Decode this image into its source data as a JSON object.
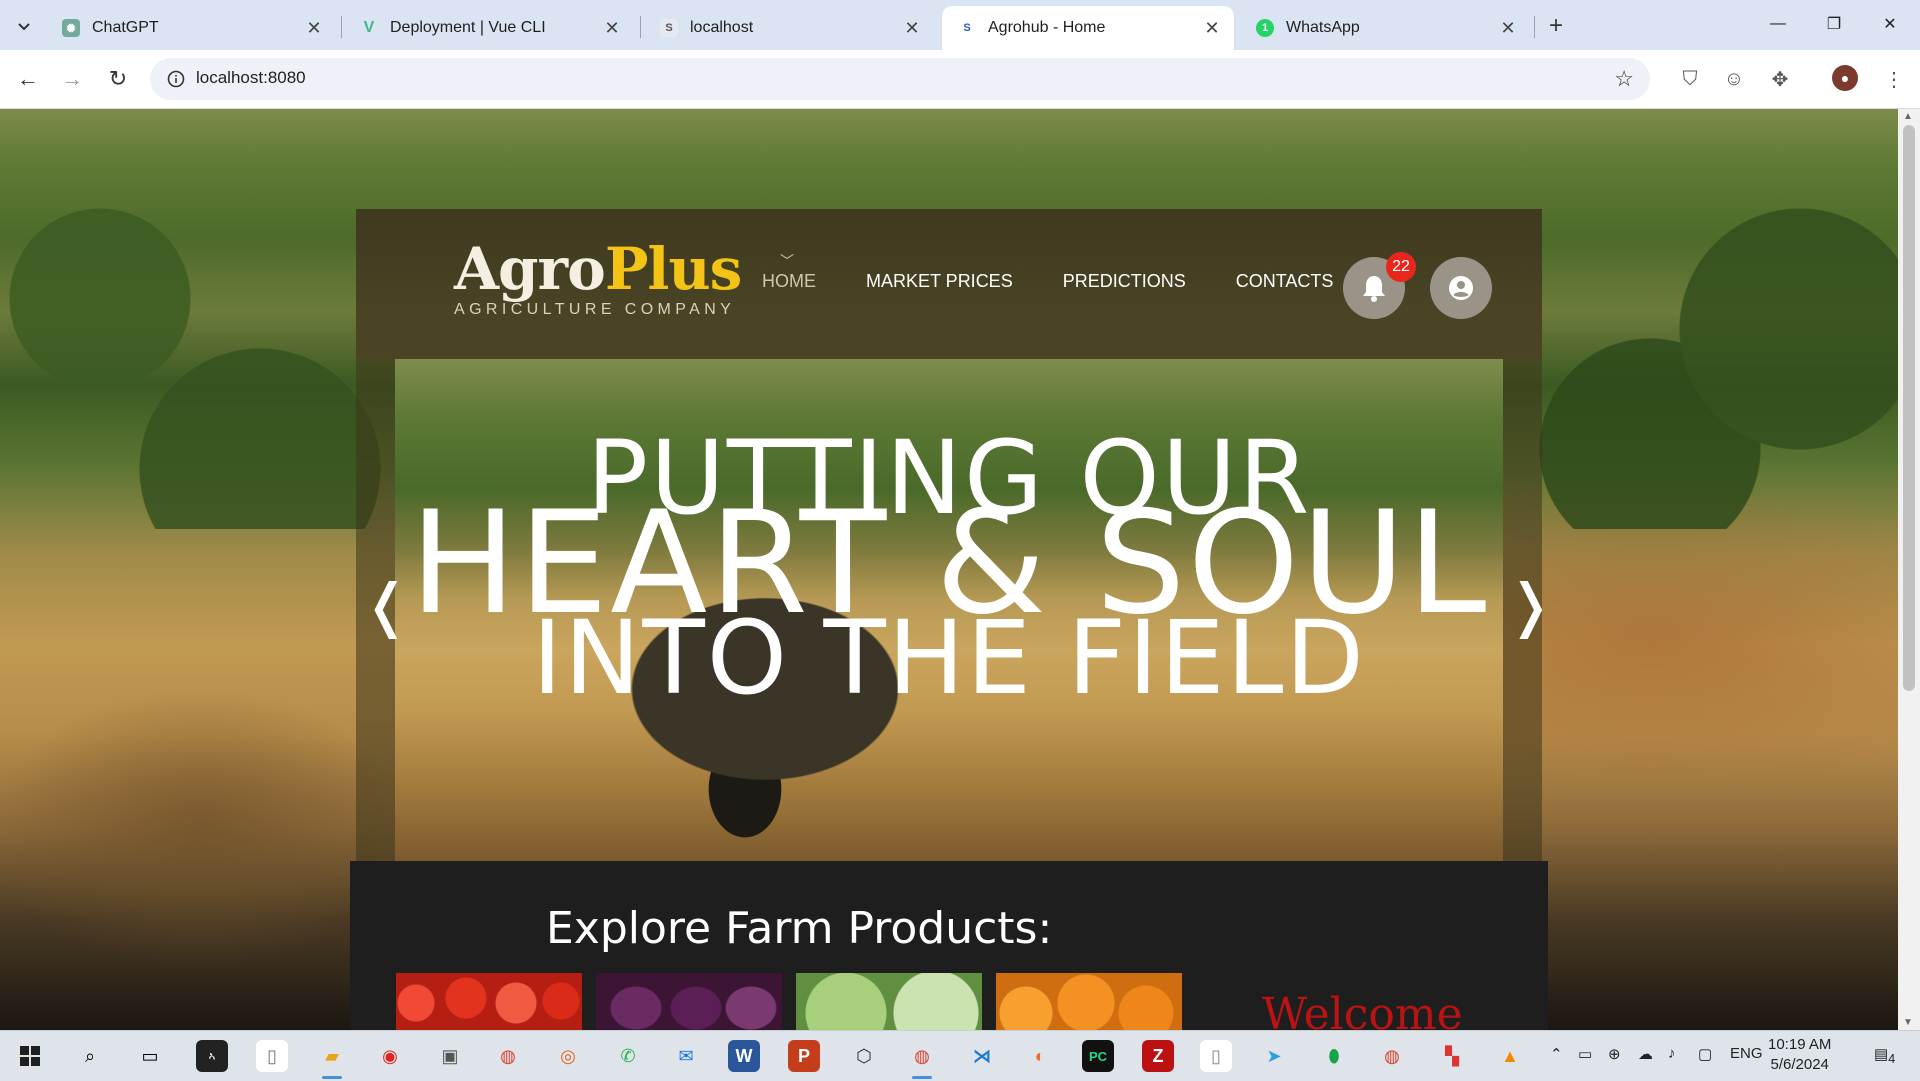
{
  "browser": {
    "tabs": [
      {
        "label": "ChatGPT",
        "icon": "chatgpt-icon",
        "active": false
      },
      {
        "label": "Deployment | Vue CLI",
        "icon": "vue-icon",
        "active": false
      },
      {
        "label": "localhost",
        "icon": "page-icon",
        "active": false
      },
      {
        "label": "Agrohub - Home",
        "icon": "page-icon",
        "active": true
      },
      {
        "label": "WhatsApp",
        "icon": "whatsapp-icon",
        "active": false
      }
    ],
    "url": "localhost:8080"
  },
  "site": {
    "logo": {
      "part1": "Agro",
      "part2": "Plus",
      "tagline": "AGRICULTURE COMPANY"
    },
    "nav": [
      {
        "label": "HOME",
        "current": true
      },
      {
        "label": "MARKET PRICES",
        "current": false
      },
      {
        "label": "PREDICTIONS",
        "current": false
      },
      {
        "label": "CONTACTS",
        "current": false
      }
    ],
    "notifications_count": "22",
    "hero": {
      "line1": "PUTTING OUR",
      "line2": "HEART & SOUL",
      "line3": "INTO THE FIELD",
      "prev": "❬",
      "next": "❭"
    },
    "products_title": "Explore Farm Products:",
    "welcome": "Welcome",
    "products": [
      {
        "name": "tomatoes",
        "color": "#d42a1c"
      },
      {
        "name": "eggplants",
        "color": "#4a1d44"
      },
      {
        "name": "cabbage",
        "color": "#7fae5a"
      },
      {
        "name": "oranges",
        "color": "#e88a1e"
      }
    ]
  },
  "taskbar": {
    "lang": "ENG",
    "time": "10:19 AM",
    "date": "5/6/2024",
    "notifications": "4"
  }
}
